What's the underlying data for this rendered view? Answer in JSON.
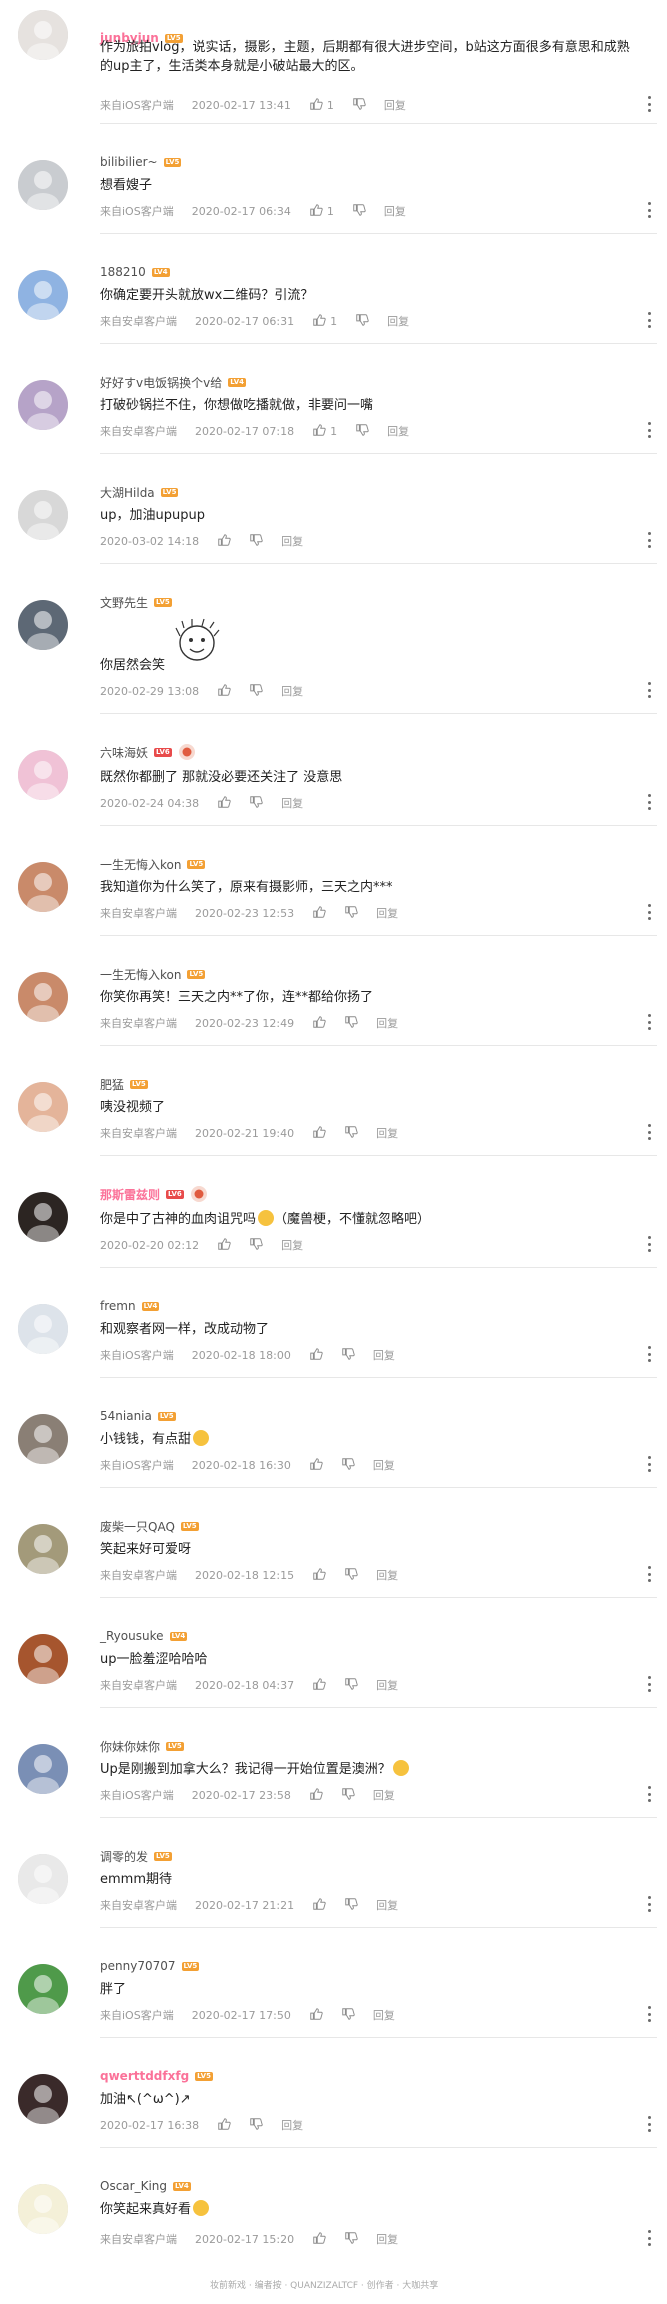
{
  "icons": {
    "like": "thumbs-up-icon",
    "dislike": "thumbs-down-icon",
    "more": "more-vertical-icon"
  },
  "colors": {
    "vip_name": "#fb7299",
    "level_badge": "#f3a034",
    "meta_text": "#9a9a9a"
  },
  "comments": [
    {
      "username": "junbyjun",
      "level": "LV5",
      "vip": true,
      "text": "作为旅拍vlog，说实话，摄影，主题，后期都有很大进步空间，b站这方面很多有意思和成熟的up主了，生活类本身就是小破站最大的区。",
      "source": "来自iOS客户端",
      "time": "2020-02-17 13:41",
      "likes": "1",
      "reply": "回复",
      "avatar_color": "#e6e2df"
    },
    {
      "username": "bilibilier~",
      "level": "LV5",
      "text": "想看嫂子",
      "source": "来自iOS客户端",
      "time": "2020-02-17 06:34",
      "likes": "1",
      "reply": "回复",
      "avatar_color": "#c9ccd0"
    },
    {
      "username": "188210",
      "level": "LV4",
      "text": "你确定要开头就放wx二维码？引流？",
      "source": "来自安卓客户端",
      "time": "2020-02-17 06:31",
      "likes": "1",
      "reply": "回复",
      "avatar_color": "#8fb3e2"
    },
    {
      "username": "好好すv电饭锅换个v给",
      "level": "LV4",
      "text": "打破砂锅拦不住，你想做吃播就做，非要问一嘴",
      "source": "来自安卓客户端",
      "time": "2020-02-17 07:18",
      "likes": "1",
      "reply": "回复",
      "avatar_color": "#b6a3c8"
    },
    {
      "username": "大湖Hilda",
      "level": "LV5",
      "text": "up，加油upupup",
      "source": "",
      "time": "2020-03-02 14:18",
      "likes": "",
      "reply": "回复",
      "avatar_color": "#d8d8d8"
    },
    {
      "username": "文野先生",
      "level": "LV5",
      "text": "你居然会笑",
      "source": "",
      "time": "2020-02-29 13:08",
      "likes": "",
      "reply": "回复",
      "avatar_color": "#5d6875"
    },
    {
      "username": "六味海妖",
      "level": "LV6",
      "text": "既然你都删了 那就没必要还关注了 没意思",
      "source": "",
      "time": "2020-02-24 04:38",
      "likes": "",
      "reply": "回复",
      "avatar_color": "#f0c2d6"
    },
    {
      "username": "一生无悔入kon",
      "level": "LV5",
      "text": "我知道你为什么笑了，原来有摄影师，三天之内***",
      "source": "来自安卓客户端",
      "time": "2020-02-23 12:53",
      "likes": "",
      "reply": "回复",
      "avatar_color": "#c98a6a"
    },
    {
      "username": "一生无悔入kon",
      "level": "LV5",
      "text": "你笑你再笑！三天之内**了你，连**都给你扬了",
      "source": "来自安卓客户端",
      "time": "2020-02-23 12:49",
      "likes": "",
      "reply": "回复",
      "avatar_color": "#c98a6a"
    },
    {
      "username": "肥猛",
      "level": "LV5",
      "text": "咦没视频了",
      "source": "来自安卓客户端",
      "time": "2020-02-21 19:40",
      "likes": "",
      "reply": "回复",
      "avatar_color": "#e4b49a"
    },
    {
      "username": "那斯雷兹则",
      "level": "LV6",
      "vip": true,
      "text": "你是中了古神的血肉诅咒吗",
      "text_suffix": "（魔兽梗，不懂就忽略吧）",
      "source": "",
      "time": "2020-02-20 02:12",
      "likes": "",
      "reply": "回复",
      "avatar_color": "#2c2522"
    },
    {
      "username": "fremn",
      "level": "LV4",
      "text": "和观察者网一样，改成动物了",
      "source": "来自iOS客户端",
      "time": "2020-02-18 18:00",
      "likes": "",
      "reply": "回复",
      "avatar_color": "#dde3ea"
    },
    {
      "username": "54niania",
      "level": "LV5",
      "text": "小钱钱，有点甜",
      "source": "来自iOS客户端",
      "time": "2020-02-18 16:30",
      "likes": "",
      "reply": "回复",
      "avatar_color": "#8a7f75"
    },
    {
      "username": "废柴一只QAQ",
      "level": "LV5",
      "text": "笑起来好可爱呀",
      "source": "来自安卓客户端",
      "time": "2020-02-18 12:15",
      "likes": "",
      "reply": "回复",
      "avatar_color": "#a39a7a"
    },
    {
      "username": "_Ryousuke",
      "level": "LV4",
      "text": "up一脸羞涩哈哈哈",
      "source": "来自安卓客户端",
      "time": "2020-02-18 04:37",
      "likes": "",
      "reply": "回复",
      "avatar_color": "#a6552e"
    },
    {
      "username": "你妹你妹你",
      "level": "LV5",
      "text": "Up是刚搬到加拿大么？我记得一开始位置是澳洲？",
      "source": "来自iOS客户端",
      "time": "2020-02-17 23:58",
      "likes": "",
      "reply": "回复",
      "avatar_color": "#7a8fb5"
    },
    {
      "username": "调零的发",
      "level": "LV5",
      "text": "emmm期待",
      "source": "来自安卓客户端",
      "time": "2020-02-17 21:21",
      "likes": "",
      "reply": "回复",
      "avatar_color": "#e9e9e9"
    },
    {
      "username": "penny70707",
      "level": "LV5",
      "text": "胖了",
      "source": "来自iOS客户端",
      "time": "2020-02-17 17:50",
      "likes": "",
      "reply": "回复",
      "avatar_color": "#4f9a4a"
    },
    {
      "username": "qwerttddfxfg",
      "level": "LV5",
      "vip": true,
      "text": "加油↖(^ω^)↗",
      "source": "",
      "time": "2020-02-17 16:38",
      "likes": "",
      "reply": "回复",
      "avatar_color": "#3a2a2a"
    },
    {
      "username": "Oscar_King",
      "level": "LV4",
      "text": "你笑起来真好看",
      "source": "来自安卓客户端",
      "time": "2020-02-17 15:20",
      "likes": "",
      "reply": "回复",
      "avatar_color": "#f4f0d8"
    }
  ],
  "footer": {
    "text": "妆前新戏 · 编者按 · QUANZIZALTCF · 创作者 · 大咖共享"
  }
}
